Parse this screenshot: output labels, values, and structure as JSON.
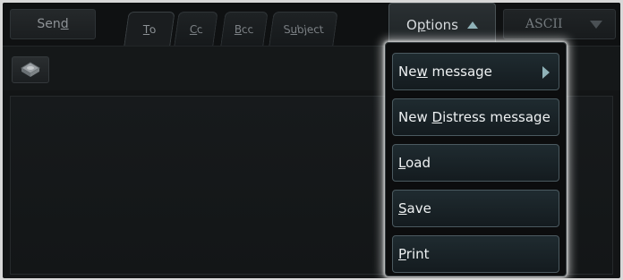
{
  "toolbar": {
    "send": {
      "pre": "Sen",
      "ul": "d",
      "post": ""
    },
    "options": {
      "pre": "O",
      "ul": "p",
      "post": "tions"
    },
    "ascii": "ASCII",
    "attach_icon": "drive-icon"
  },
  "tabs": [
    {
      "pre": "",
      "ul": "T",
      "post": "o"
    },
    {
      "pre": "",
      "ul": "C",
      "post": "c"
    },
    {
      "pre": "",
      "ul": "B",
      "post": "cc"
    },
    {
      "pre": "S",
      "ul": "u",
      "post": "bject"
    }
  ],
  "menu": {
    "items": [
      {
        "pre": "Ne",
        "ul": "w",
        "post": " message"
      },
      {
        "pre": "New ",
        "ul": "D",
        "post": "istress message"
      },
      {
        "pre": "",
        "ul": "L",
        "post": "oad"
      },
      {
        "pre": "",
        "ul": "S",
        "post": "ave"
      },
      {
        "pre": "",
        "ul": "P",
        "post": "rint"
      }
    ]
  },
  "colors": {
    "accent": "#8fb2b8",
    "menu_border": "#4b5a60"
  }
}
